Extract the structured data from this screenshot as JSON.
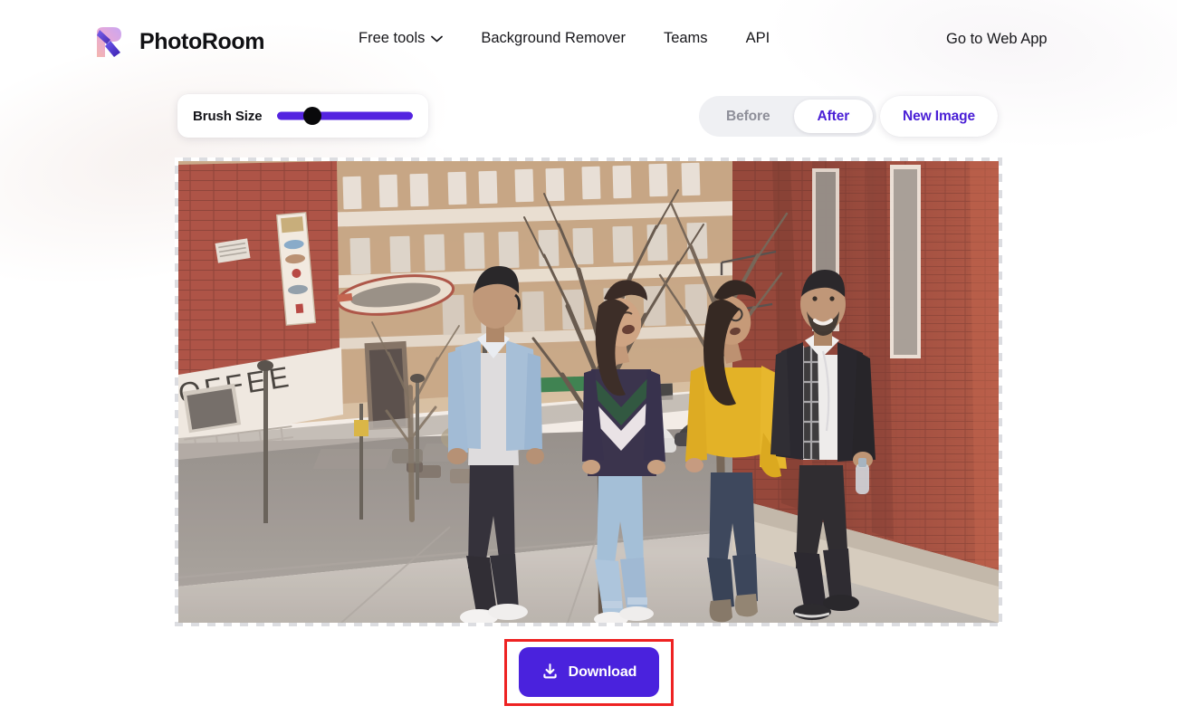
{
  "brand": {
    "name": "PhotoRoom",
    "logo_icon": "photoroom-r-logo-icon"
  },
  "nav": {
    "items": [
      {
        "label": "Free tools",
        "icon": "chevron-down-icon",
        "has_dropdown": true
      },
      {
        "label": "Background Remover",
        "has_dropdown": false
      },
      {
        "label": "Teams",
        "has_dropdown": false
      },
      {
        "label": "API",
        "has_dropdown": false
      }
    ],
    "cta_label": "Go to Web App"
  },
  "toolbar": {
    "brush": {
      "label": "Brush Size",
      "value_percent": 26,
      "min": 0,
      "max": 100,
      "track_color": "#5424e0",
      "thumb_color": "#09090b"
    },
    "view_toggle": {
      "options": [
        "Before",
        "After"
      ],
      "selected": "After",
      "inactive_color": "#8e8f99",
      "active_color": "#4a1fd6",
      "group_bg": "#eff0f3"
    },
    "new_image_label": "New Image"
  },
  "canvas": {
    "transparency_checker": true,
    "image_alt": "Four friends walking and laughing on a city sidewalk beside a red brick building",
    "scene": {
      "sign_text": "OFFEE",
      "people": 4
    }
  },
  "download": {
    "label": "Download",
    "icon": "download-icon",
    "button_color": "#4a22dd",
    "highlight_box_color": "#ee2222",
    "highlighted": true
  }
}
